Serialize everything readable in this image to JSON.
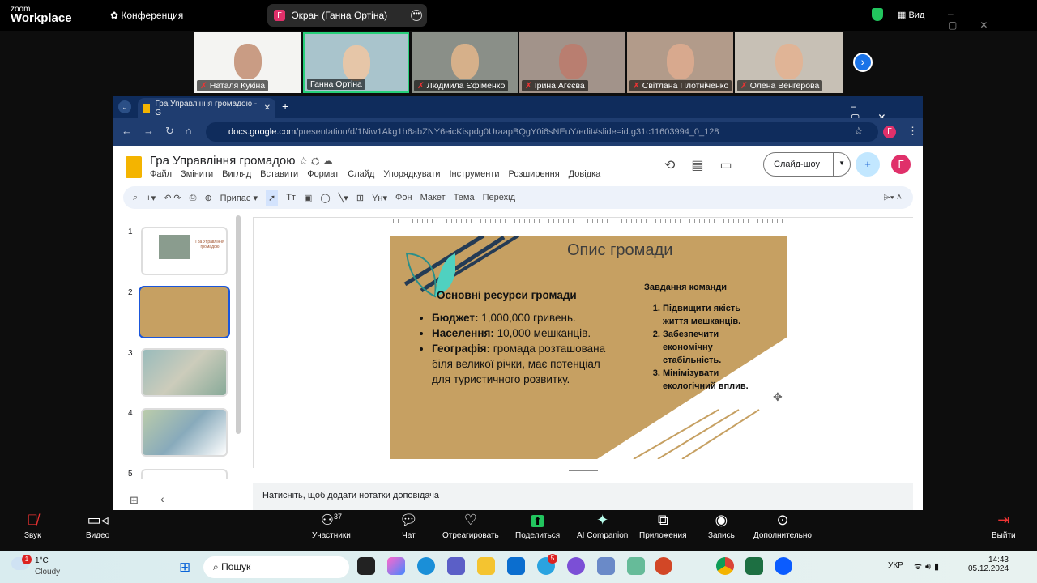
{
  "zoom": {
    "logo_small": "zoom",
    "logo_big": "Workplace",
    "meeting_label": "Конференция",
    "share_pill": "Экран (Ганна Ортіна)",
    "share_avatar": "Г",
    "view_label": "Вид"
  },
  "participants": [
    {
      "name": "Наталя Кукіна",
      "muted": true
    },
    {
      "name": "Ганна Ортіна",
      "muted": false,
      "active": true
    },
    {
      "name": "Людмила Єфіменко",
      "muted": true
    },
    {
      "name": "Ірина Агєєва",
      "muted": true
    },
    {
      "name": "Світлана Плотніченко",
      "muted": true
    },
    {
      "name": "Олена Венгерова",
      "muted": true
    }
  ],
  "browser": {
    "tab_title": "Гра Управління громадою - G",
    "url_host": "docs.google.com",
    "url_path": "/presentation/d/1Niw1Akg1h6abZNY6eicKispdg0UraapBQgY0i6sNEuY/edit#slide=id.g31c11603994_0_128",
    "profile": "Г"
  },
  "docs": {
    "title": "Гра Управління громадою",
    "menu": [
      "Файл",
      "Змінити",
      "Вигляд",
      "Вставити",
      "Формат",
      "Слайд",
      "Упорядкувати",
      "Інструменти",
      "Розширення",
      "Довідка"
    ],
    "slideshow": "Слайд-шоу",
    "avatar": "Г",
    "toolbar": {
      "zoom": "Припас",
      "bg": "Фон",
      "layout": "Макет",
      "theme": "Тема",
      "transition": "Перехід"
    },
    "speaker_notes": "Натисніть, щоб додати нотатки доповідача",
    "thumbnails": [
      "1",
      "2",
      "3",
      "4",
      "5"
    ],
    "thumb1_title": "Гра Управління громадою"
  },
  "slide": {
    "title": "Опис громади",
    "resources_heading": "Основні ресурси громади",
    "bullets": [
      {
        "label": "Бюджет:",
        "text": " 1,000,000 гривень."
      },
      {
        "label": "Населення:",
        "text": " 10,000 мешканців."
      },
      {
        "label": "Географія:",
        "text": " громада розташована біля великої річки, має потенціал для туристичного розвитку."
      }
    ],
    "tasks_heading": "Завдання команди",
    "tasks": [
      "Підвищити якість життя мешканців.",
      "Забезпечити економічну стабільність.",
      "Мінімізувати екологічний вплив."
    ]
  },
  "controls": {
    "audio": "Звук",
    "video": "Видео",
    "participants": "Участники",
    "participants_count": "37",
    "chat": "Чат",
    "react": "Отреагировать",
    "share": "Поделиться",
    "ai": "AI Companion",
    "apps": "Приложения",
    "record": "Запись",
    "more": "Дополнительно",
    "leave": "Выйти"
  },
  "taskbar": {
    "temp": "1°C",
    "weather": "Cloudy",
    "weather_badge": "1",
    "search": "Пошук",
    "telegram_badge": "5",
    "lang": "УКР",
    "time": "14:43",
    "date": "05.12.2024"
  }
}
